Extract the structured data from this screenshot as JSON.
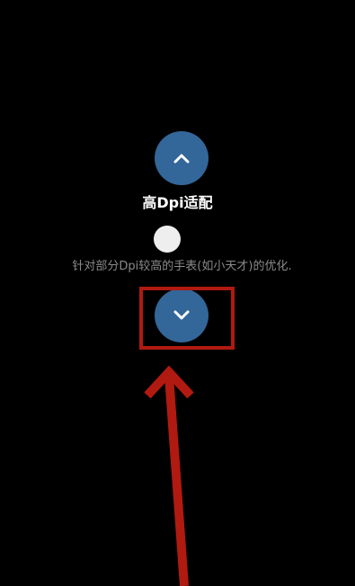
{
  "setting": {
    "title": "高Dpi适配",
    "description": "针对部分Dpi较高的手表(如小天才)的优化.",
    "enabled": false
  },
  "nav": {
    "up_icon": "chevron-up-icon",
    "down_icon": "chevron-down-icon"
  },
  "colors": {
    "background": "#000000",
    "button": "#336699",
    "toggle_off": "#eeeeee",
    "annotation": "#b01a10"
  }
}
